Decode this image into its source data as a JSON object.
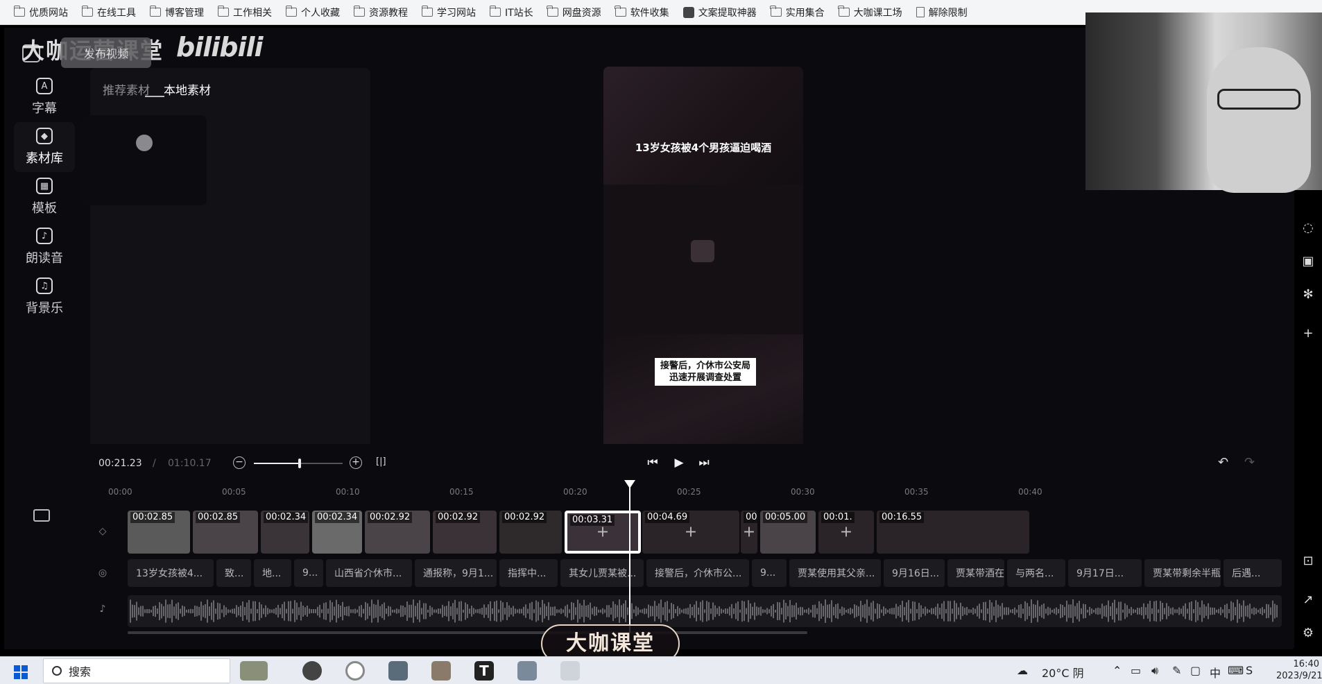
{
  "bookmarks": [
    {
      "label": "优质网站",
      "icon": "folder-icon"
    },
    {
      "label": "在线工具",
      "icon": "folder-icon"
    },
    {
      "label": "博客管理",
      "icon": "folder-icon"
    },
    {
      "label": "工作相关",
      "icon": "folder-icon"
    },
    {
      "label": "个人收藏",
      "icon": "folder-icon"
    },
    {
      "label": "资源教程",
      "icon": "folder-icon"
    },
    {
      "label": "学习网站",
      "icon": "folder-icon"
    },
    {
      "label": "IT站长",
      "icon": "folder-icon"
    },
    {
      "label": "网盘资源",
      "icon": "folder-icon"
    },
    {
      "label": "软件收集",
      "icon": "folder-icon"
    },
    {
      "label": "文案提取神器",
      "icon": "app-icon"
    },
    {
      "label": "实用集合",
      "icon": "folder-icon"
    },
    {
      "label": "大咖课工场",
      "icon": "folder-icon"
    },
    {
      "label": "解除限制",
      "icon": "doc-icon"
    }
  ],
  "header": {
    "brand_watermark": "大咖运营课堂",
    "bilibili_logo": "bilibili",
    "publish_button": "发布视频"
  },
  "sidebar": {
    "items": [
      {
        "label": "字幕",
        "icon": "subtitle-icon",
        "glyph": "A"
      },
      {
        "label": "素材库",
        "icon": "layers-icon",
        "glyph": "◆"
      },
      {
        "label": "模板",
        "icon": "template-icon",
        "glyph": "▦"
      },
      {
        "label": "朗读音",
        "icon": "voice-icon",
        "glyph": "♪"
      },
      {
        "label": "背景乐",
        "icon": "music-icon",
        "glyph": "♫"
      }
    ],
    "active": "素材库"
  },
  "material": {
    "tabs": [
      "推荐素材",
      "本地素材"
    ],
    "active_tab": "本地素材"
  },
  "preview": {
    "title_text": "13岁女孩被4个男孩逼迫喝酒",
    "caption_line1": "接警后，介休市公安局",
    "caption_line2": "迅速开展调查处置"
  },
  "timeline": {
    "current_time": "00:21.23",
    "separator": "/",
    "total_time": "01:10.17",
    "ruler": [
      "00:00",
      "00:05",
      "00:10",
      "00:15",
      "00:20",
      "00:25",
      "00:30",
      "00:35",
      "00:40"
    ],
    "video_clips": [
      "00:02.85",
      "00:02.85",
      "00:02.34",
      "00:02.34",
      "00:02.92",
      "00:02.92",
      "00:02.92",
      "00:03.31",
      "00:04.69",
      "00:",
      "00:05.00",
      "00:01.",
      "00:16.55"
    ],
    "selected_clip": "00:03.31",
    "subtitles": [
      "13岁女孩被4...",
      "致...",
      "地...",
      "9...",
      "山西省介休市...",
      "通报称，9月1...",
      "指挥中...",
      "其女儿贾某被...",
      "接警后，介休市公...",
      "9...",
      "贾某使用其父亲...",
      "9月16日...",
      "贾某带酒在...",
      "与两名...",
      "9月17日...",
      "贾某带剩余半瓶酒...",
      "后遇..."
    ]
  },
  "watermark_bottom": "大咖课堂",
  "taskbar": {
    "search_label": "搜索",
    "weather": "20°C 阴",
    "ime": "中",
    "time": "16:40",
    "date": "2023/9/21"
  }
}
